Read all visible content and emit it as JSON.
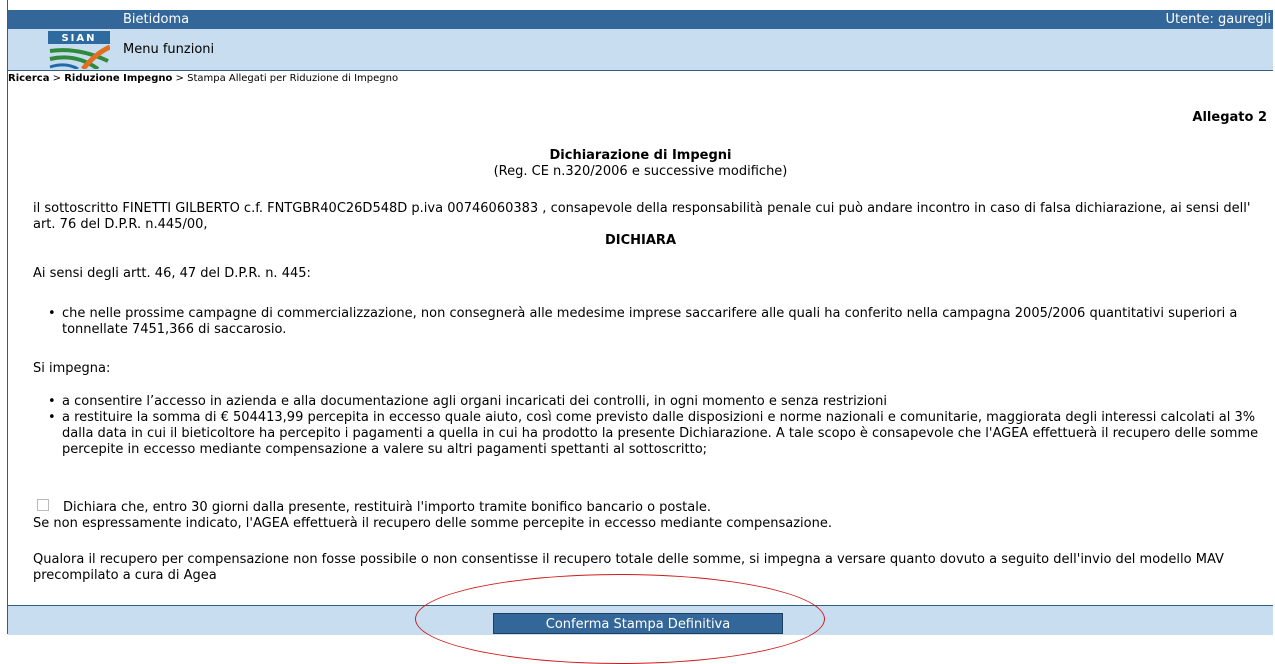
{
  "header": {
    "app_title": "Bietidoma",
    "user_label": "Utente: gauregli",
    "logo_text": "SIAN",
    "menu_label": "Menu funzioni"
  },
  "breadcrumb": {
    "item1": "Ricerca",
    "sep1": " > ",
    "item2": "Riduzione Impegno",
    "sep2": " > ",
    "item3": "Stampa Allegati per Riduzione di Impegno"
  },
  "document": {
    "allegato": "Allegato 2",
    "title": "Dichiarazione di Impegni",
    "subtitle": "(Reg. CE n.320/2006 e successive modifiche)",
    "intro": "il sottoscritto FINETTI GILBERTO  c.f. FNTGBR40C26D548D p.iva 00746060383 , consapevole della responsabilità penale cui può andare incontro in caso di falsa dichiarazione, ai sensi dell' art. 76 del D.P.R. n.445/00,",
    "dichiara": "DICHIARA",
    "ai_sensi": "Ai sensi degli artt. 46, 47 del D.P.R. n. 445:",
    "bullet1": "che nelle prossime campagne di commercializzazione, non consegnerà alle medesime imprese saccarifere alle quali ha conferito nella campagna  2005/2006  quantitativi superiori a tonnellate 7451,366 di saccarosio.",
    "si_impegna": "Si impegna:",
    "bullet2": "a consentire l’accesso in azienda e alla documentazione agli organi incaricati dei controlli, in ogni momento e senza restrizioni",
    "bullet3": "a restituire la somma di € 504413,99  percepita in eccesso quale aiuto, così come previsto dalle disposizioni e norme nazionali e comunitarie, maggiorata degli interessi calcolati al 3% dalla data in cui il bieticoltore ha percepito i pagamenti a quella in cui ha prodotto la presente Dichiarazione. A tale scopo è consapevole che l'AGEA effettuerà il recupero delle somme percepite in eccesso mediante compensazione a valere su altri pagamenti spettanti al sottoscritto;",
    "checkbox_label": "Dichiara che, entro 30 giorni dalla presente, restituirà l'importo tramite bonifico bancario o postale.",
    "checkbox_checked": false,
    "note": "Se non espressamente indicato, l'AGEA effettuerà il recupero delle somme percepite in eccesso mediante compensazione.",
    "closing": "Qualora il recupero per compensazione non fosse possibile o non consentisse il recupero totale delle somme, si impegna a versare quanto dovuto a seguito dell'invio del modello MAV precompilato a cura di Agea"
  },
  "footer": {
    "confirm_label": "Conferma Stampa Definitiva"
  },
  "colors": {
    "header_blue": "#336699",
    "menu_bg": "#c8def0",
    "annotation_red": "#d01a1a"
  }
}
